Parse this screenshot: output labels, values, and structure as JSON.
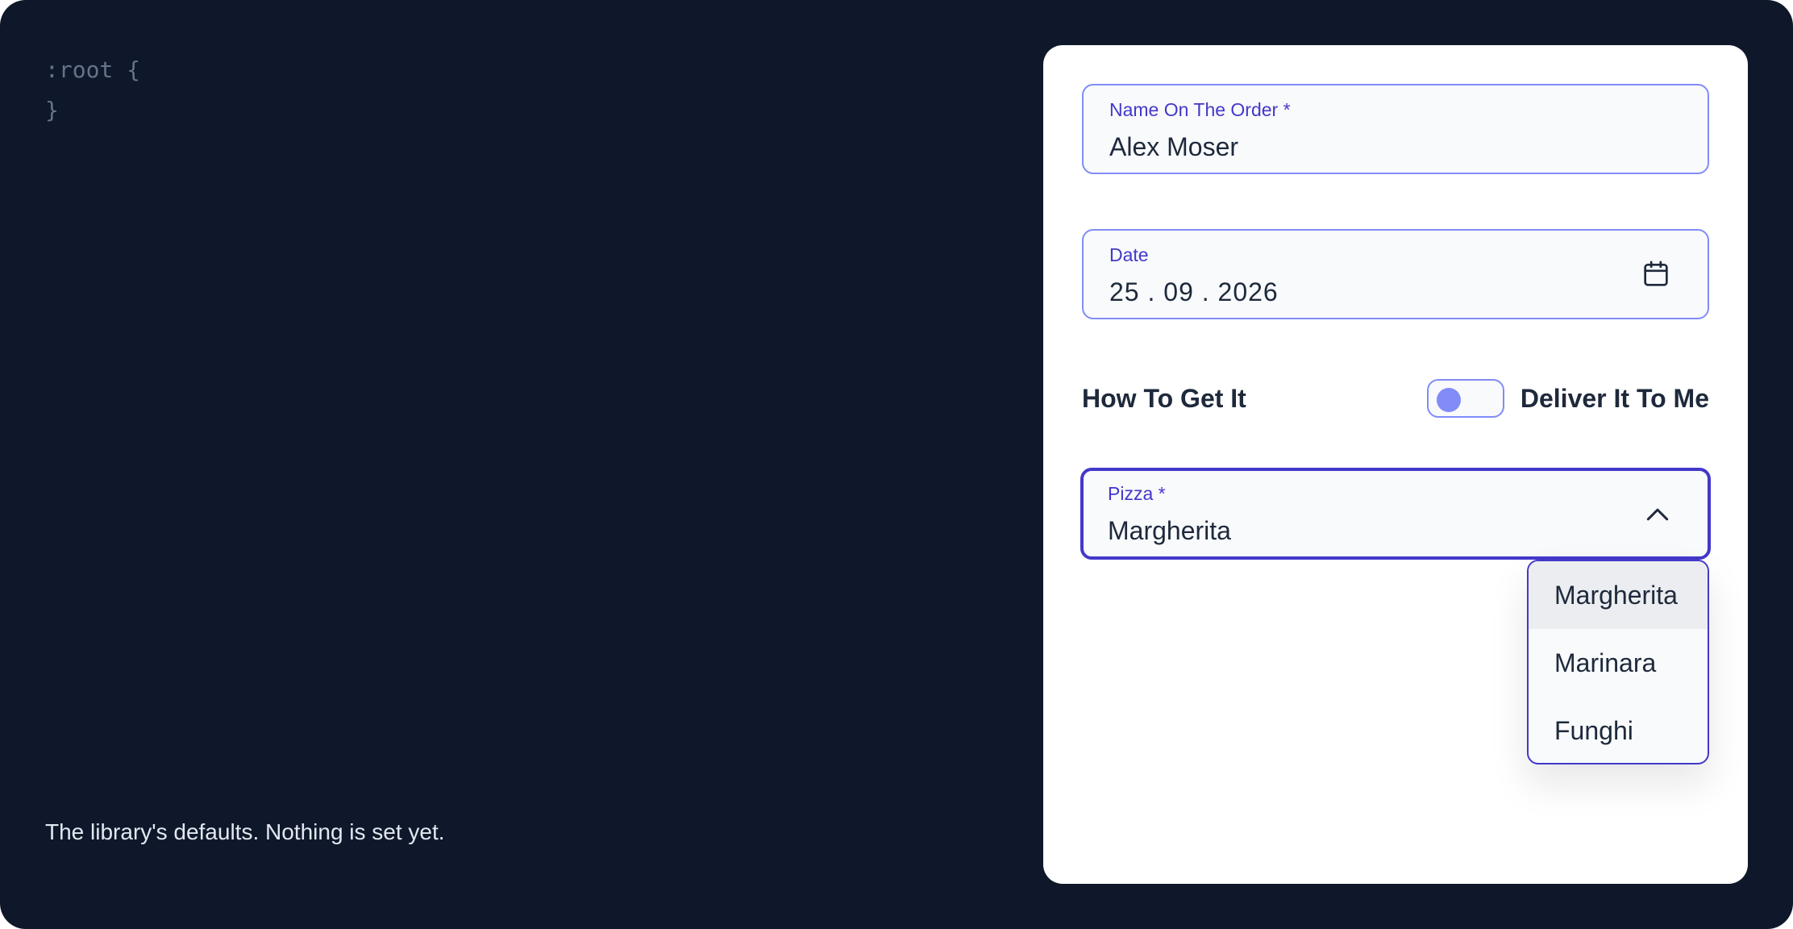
{
  "code": {
    "lines": [
      ":root {",
      "}"
    ]
  },
  "caption": "The library's defaults. Nothing is set yet.",
  "form": {
    "name_field": {
      "label": "Name On The Order *",
      "value": "Alex Moser"
    },
    "date_field": {
      "label": "Date",
      "value": "25 . 09 . 2026",
      "icon": "calendar-icon"
    },
    "delivery": {
      "title": "How To Get It",
      "toggle_label": "Deliver It To Me",
      "toggle_on": false
    },
    "pizza_field": {
      "label": "Pizza *",
      "value": "Margherita",
      "icon": "chevron-up-icon",
      "expanded": true,
      "options": [
        "Margherita",
        "Marinara",
        "Funghi"
      ],
      "selected_index": 0
    }
  },
  "colors": {
    "background": "#0f172a",
    "panel": "#ffffff",
    "accent": "#4338ca",
    "accent_light": "#818cf8",
    "field_bg": "#f8fafc",
    "text": "#1e293b",
    "code_text": "#64748b",
    "caption_text": "#e2e8f0"
  }
}
